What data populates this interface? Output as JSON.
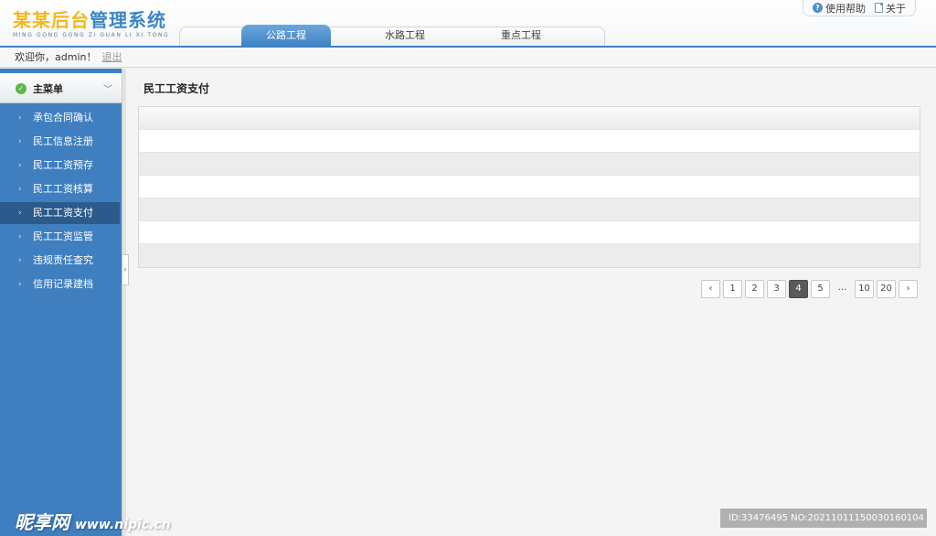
{
  "logo": {
    "title_part_a": "某某后台",
    "title_part_b": "管理系统",
    "subtitle": "MING GONG GONG ZI GUAN LI XI TONG"
  },
  "header": {
    "tabs": [
      {
        "label": "公路工程",
        "active": true
      },
      {
        "label": "水路工程",
        "active": false
      },
      {
        "label": "重点工程",
        "active": false
      }
    ],
    "links": {
      "help": "使用帮助",
      "about": "关于"
    }
  },
  "welcome": {
    "greeting": "欢迎你，admin！",
    "logout": "退出"
  },
  "sidebar": {
    "title": "主菜单",
    "items": [
      {
        "label": "承包合同确认"
      },
      {
        "label": "民工信息注册"
      },
      {
        "label": "民工工资预存"
      },
      {
        "label": "民工工资核算"
      },
      {
        "label": "民工工资支付",
        "active": true
      },
      {
        "label": "民工工资监管"
      },
      {
        "label": "违规责任查究"
      },
      {
        "label": "信用记录建档"
      }
    ]
  },
  "main": {
    "title": "民工工资支付"
  },
  "pagination": {
    "prev": "‹",
    "pages": [
      "1",
      "2",
      "3",
      "4",
      "5",
      "...",
      "10",
      "20"
    ],
    "current": "4",
    "next": "›"
  },
  "watermark": {
    "logo": "昵享网",
    "url": "www.nipic.cn",
    "id": "ID:33476495 NO:20211011150030160104"
  },
  "colors": {
    "primary": "#3f7fc0",
    "active_menu": "#2b5b8c",
    "logo_yellow": "#f2b81e",
    "logo_blue": "#3c86c8"
  }
}
